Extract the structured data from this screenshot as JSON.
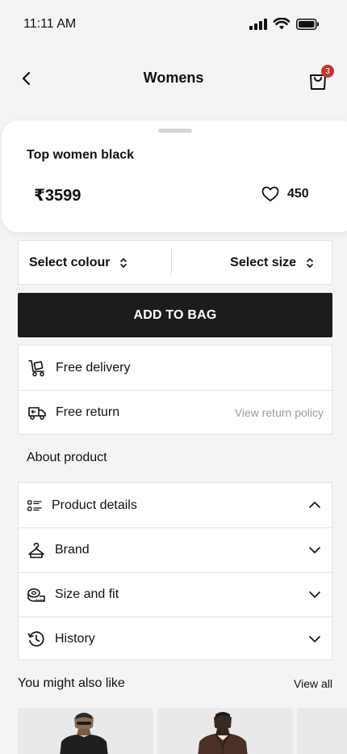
{
  "status": {
    "time": "11:11 AM"
  },
  "header": {
    "title": "Womens",
    "bag_count": "3"
  },
  "product": {
    "name": "Top women black",
    "price": "₹3599",
    "likes": "450"
  },
  "selectors": {
    "colour_label": "Select colour",
    "size_label": "Select size"
  },
  "add_to_bag": "ADD TO BAG",
  "delivery": {
    "free_delivery": "Free delivery",
    "free_return": "Free return",
    "return_policy_link": "View return policy"
  },
  "about": {
    "title": "About product",
    "items": [
      {
        "label": "Product details",
        "icon": "list-icon",
        "expanded": true
      },
      {
        "label": "Brand",
        "icon": "hanger-icon",
        "expanded": false
      },
      {
        "label": "Size and fit",
        "icon": "measuring-tape-icon",
        "expanded": false
      },
      {
        "label": "History",
        "icon": "history-icon",
        "expanded": false
      }
    ]
  },
  "recommendations": {
    "title": "You might also like",
    "view_all": "View all"
  },
  "colors": {
    "accent": "#1c1c1c",
    "badge": "#c0392b",
    "muted": "#9a9a9a"
  }
}
